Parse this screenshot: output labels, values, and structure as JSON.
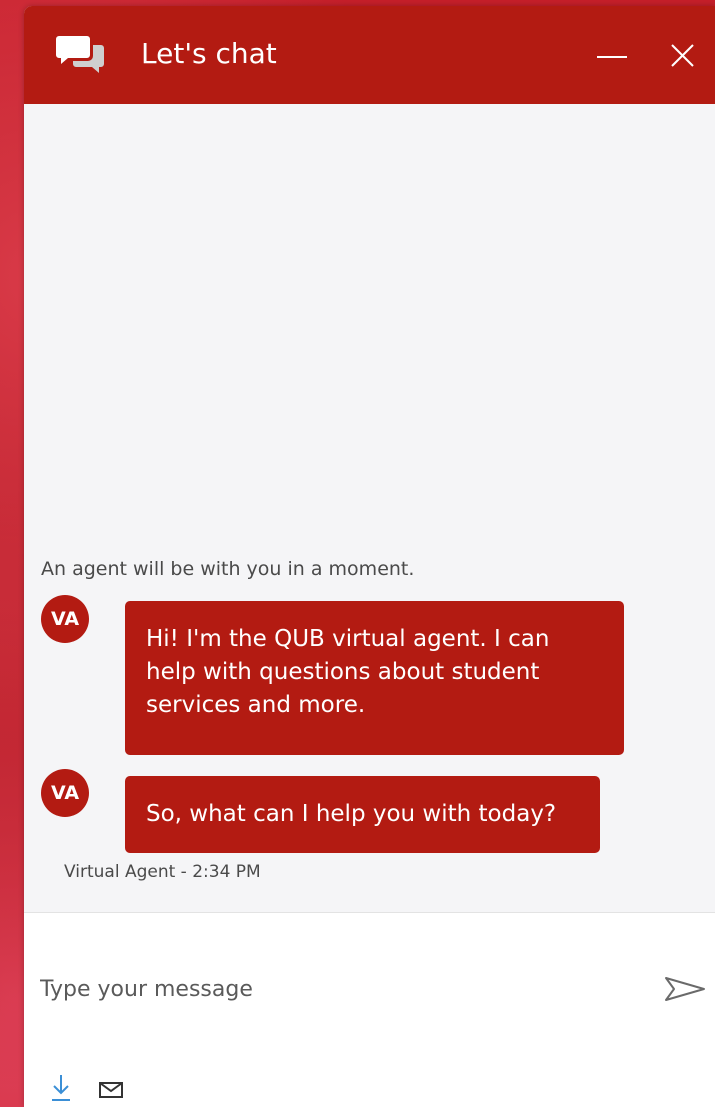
{
  "header": {
    "title": "Let's chat",
    "icon": "chat-bubbles-icon",
    "minimize_icon": "minimize-icon",
    "close_icon": "close-icon"
  },
  "conversation": {
    "system_note": "An agent will be with you in a moment.",
    "messages": [
      {
        "avatar": "VA",
        "lines": [
          "Hi! I'm the QUB virtual agent. I can",
          "help with questions about student",
          "services and more."
        ]
      },
      {
        "avatar": "VA",
        "lines": [
          "So, what can I help you with today?"
        ]
      }
    ],
    "timestamp": "Virtual Agent - 2:34 PM"
  },
  "composer": {
    "placeholder": "Type your message",
    "value": "",
    "send_icon": "send-icon",
    "download_icon": "download-icon",
    "email_icon": "email-icon"
  },
  "colors": {
    "brand": "#b31b12",
    "panel_background": "#f5f5f7",
    "composer_background": "#ffffff",
    "link_accent": "#3b8fd6"
  }
}
